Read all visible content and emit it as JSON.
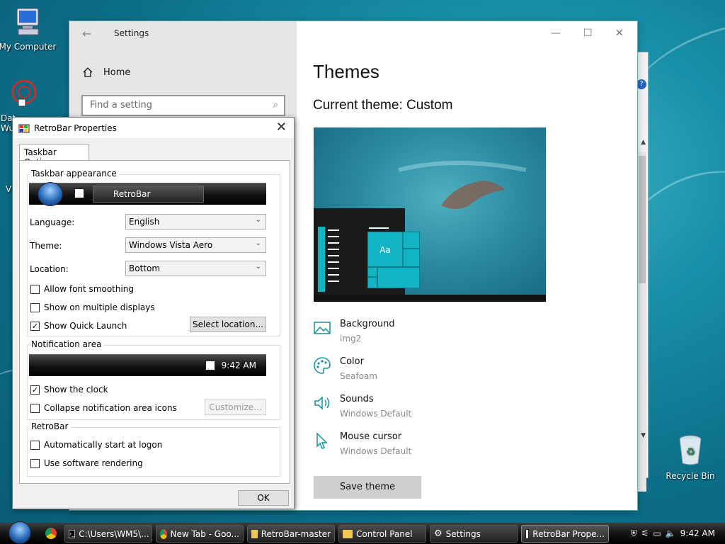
{
  "desktop": {
    "icons": [
      {
        "label": "My Computer"
      },
      {
        "label": "Dat Wu"
      },
      {
        "label": "V"
      },
      {
        "label": "Recycle Bin"
      }
    ]
  },
  "settings": {
    "window_title": "Settings",
    "home_label": "Home",
    "search_placeholder": "Find a setting",
    "page_title": "Themes",
    "current_theme": "Current theme: Custom",
    "preview_tile_text": "Aa",
    "rows": [
      {
        "title": "Background",
        "value": "img2",
        "icon": "picture-icon"
      },
      {
        "title": "Color",
        "value": "Seafoam",
        "icon": "palette-icon"
      },
      {
        "title": "Sounds",
        "value": "Windows Default",
        "icon": "speaker-icon"
      },
      {
        "title": "Mouse cursor",
        "value": "Windows Default",
        "icon": "cursor-icon"
      }
    ],
    "save_theme": "Save theme",
    "accent_color": "#1292a6"
  },
  "retrobar": {
    "title": "RetroBar Properties",
    "tab": "Taskbar Options",
    "appearance_group": "Taskbar appearance",
    "preview_button": "RetroBar",
    "language_label": "Language:",
    "language_value": "English",
    "theme_label": "Theme:",
    "theme_value": "Windows Vista Aero",
    "location_label": "Location:",
    "location_value": "Bottom",
    "font_smoothing": {
      "label": "Allow font smoothing",
      "checked": false
    },
    "multiple_displays": {
      "label": "Show on multiple displays",
      "checked": false
    },
    "quick_launch": {
      "label": "Show Quick Launch",
      "checked": true
    },
    "select_location": "Select location...",
    "notification_group": "Notification area",
    "clock_preview": "9:42 AM",
    "show_clock": {
      "label": "Show the clock",
      "checked": true
    },
    "collapse_icons": {
      "label": "Collapse notification area icons",
      "checked": false
    },
    "customize": "Customize...",
    "retrobar_group": "RetroBar",
    "auto_start": {
      "label": "Automatically start at logon",
      "checked": false
    },
    "software_rendering": {
      "label": "Use software rendering",
      "checked": false
    },
    "ok": "OK"
  },
  "taskbar": {
    "buttons": [
      {
        "label": "C:\\Users\\WM5\\...",
        "icon": "cmd-icon"
      },
      {
        "label": "New Tab - Goo...",
        "icon": "chrome-icon"
      },
      {
        "label": "RetroBar-master",
        "icon": "folder-icon"
      },
      {
        "label": "Control Panel",
        "icon": "folder-icon"
      },
      {
        "label": "Settings",
        "icon": "gear-icon"
      },
      {
        "label": "RetroBar Prope...",
        "icon": "retrobar-icon"
      }
    ],
    "clock": "9:42 AM"
  }
}
